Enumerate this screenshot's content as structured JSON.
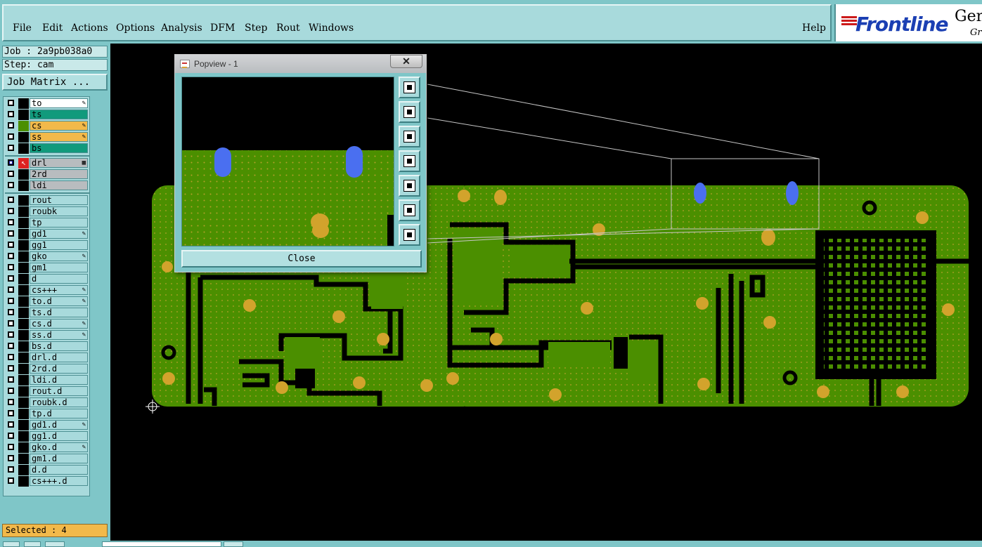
{
  "menu": {
    "file": "File",
    "edit": "Edit",
    "actions": "Actions",
    "options": "Options",
    "analysis": "Analysis",
    "dfm": "DFM",
    "step": "Step",
    "rout": "Rout",
    "windows": "Windows",
    "help": "Help"
  },
  "logo": {
    "brand": "Frontline",
    "product": "Gen",
    "sub": "Gr"
  },
  "job": {
    "label": "Job : 2a9pb038a0",
    "step": "Step: cam",
    "matrix_button": "Job Matrix ..."
  },
  "layers": [
    {
      "name": "to",
      "color": "#ffffff",
      "flag": "✎"
    },
    {
      "name": "ts",
      "color": "#119a7c",
      "flag": ""
    },
    {
      "name": "cs",
      "color": "#f2b94a",
      "flag": "✎"
    },
    {
      "name": "ss",
      "color": "#f2b94a",
      "flag": "✎"
    },
    {
      "name": "bs",
      "color": "#119a7c",
      "flag": ""
    },
    {
      "name": "drl",
      "color": "#b8bcbf",
      "flag": "▦"
    },
    {
      "name": "2rd",
      "color": "#b8bcbf",
      "flag": ""
    },
    {
      "name": "ldi",
      "color": "#b8bcbf",
      "flag": ""
    },
    {
      "name": "rout",
      "color": "#a8dadc",
      "flag": ""
    },
    {
      "name": "roubk",
      "color": "#a8dadc",
      "flag": ""
    },
    {
      "name": "tp",
      "color": "#a8dadc",
      "flag": ""
    },
    {
      "name": "gd1",
      "color": "#a8dadc",
      "flag": "✎"
    },
    {
      "name": "gg1",
      "color": "#a8dadc",
      "flag": ""
    },
    {
      "name": "gko",
      "color": "#a8dadc",
      "flag": "✎"
    },
    {
      "name": "gm1",
      "color": "#a8dadc",
      "flag": ""
    },
    {
      "name": "d",
      "color": "#a8dadc",
      "flag": ""
    },
    {
      "name": "cs+++",
      "color": "#a8dadc",
      "flag": "✎"
    },
    {
      "name": "to.d",
      "color": "#a8dadc",
      "flag": "✎"
    },
    {
      "name": "ts.d",
      "color": "#a8dadc",
      "flag": ""
    },
    {
      "name": "cs.d",
      "color": "#a8dadc",
      "flag": "✎"
    },
    {
      "name": "ss.d",
      "color": "#a8dadc",
      "flag": "✎"
    },
    {
      "name": "bs.d",
      "color": "#a8dadc",
      "flag": ""
    },
    {
      "name": "drl.d",
      "color": "#a8dadc",
      "flag": ""
    },
    {
      "name": "2rd.d",
      "color": "#a8dadc",
      "flag": ""
    },
    {
      "name": "ldi.d",
      "color": "#a8dadc",
      "flag": ""
    },
    {
      "name": "rout.d",
      "color": "#a8dadc",
      "flag": ""
    },
    {
      "name": "roubk.d",
      "color": "#a8dadc",
      "flag": ""
    },
    {
      "name": "tp.d",
      "color": "#a8dadc",
      "flag": ""
    },
    {
      "name": "gd1.d",
      "color": "#a8dadc",
      "flag": "✎"
    },
    {
      "name": "gg1.d",
      "color": "#a8dadc",
      "flag": ""
    },
    {
      "name": "gko.d",
      "color": "#a8dadc",
      "flag": "✎"
    },
    {
      "name": "gm1.d",
      "color": "#a8dadc",
      "flag": ""
    },
    {
      "name": "d.d",
      "color": "#a8dadc",
      "flag": ""
    },
    {
      "name": "cs+++.d",
      "color": "#a8dadc",
      "flag": ""
    }
  ],
  "status": {
    "selected": "Selected : 4"
  },
  "popview": {
    "title": "Popview - 1",
    "close_label": "Close",
    "close_x": "✕"
  },
  "colors": {
    "board": "#4b8f00",
    "pad": "#d2a32c",
    "hole": "#4a6ff0",
    "panel": "#7fc6c8"
  }
}
